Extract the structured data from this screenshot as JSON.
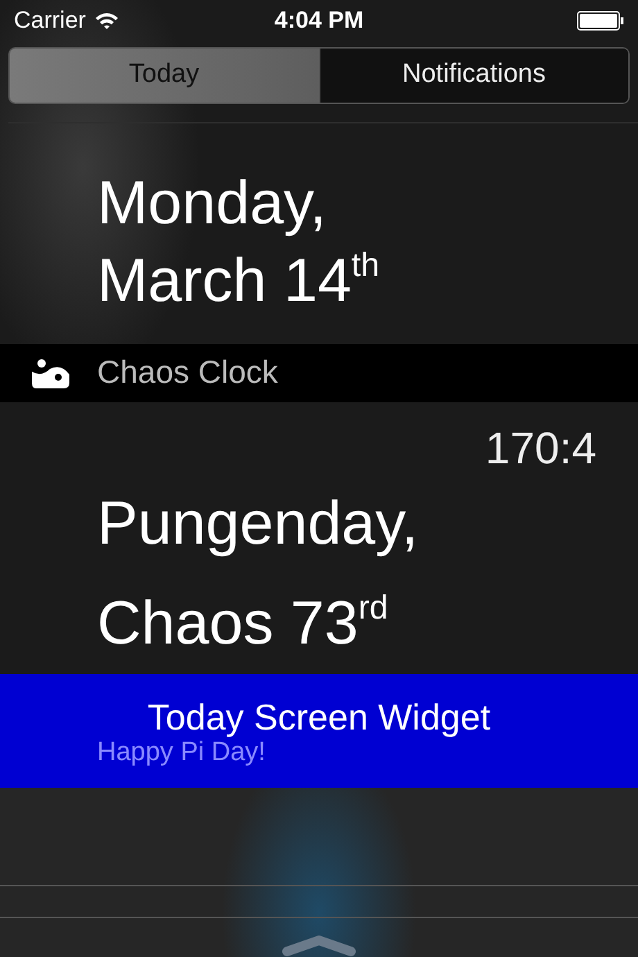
{
  "status_bar": {
    "carrier": "Carrier",
    "time": "4:04 PM"
  },
  "tabs": [
    {
      "label": "Today",
      "selected": true
    },
    {
      "label": "Notifications",
      "selected": false
    }
  ],
  "date": {
    "lines": [
      "Monday,",
      "March 14$^{th}$"
    ]
  },
  "widget": {
    "app_name": "Chaos Clock",
    "time": "170:4",
    "lines": [
      "Pungenday,",
      "Chaos 73$^{rd}$"
    ],
    "message": "Happy Pi Day!"
  },
  "banner": {
    "title": "Today Screen Widget"
  }
}
